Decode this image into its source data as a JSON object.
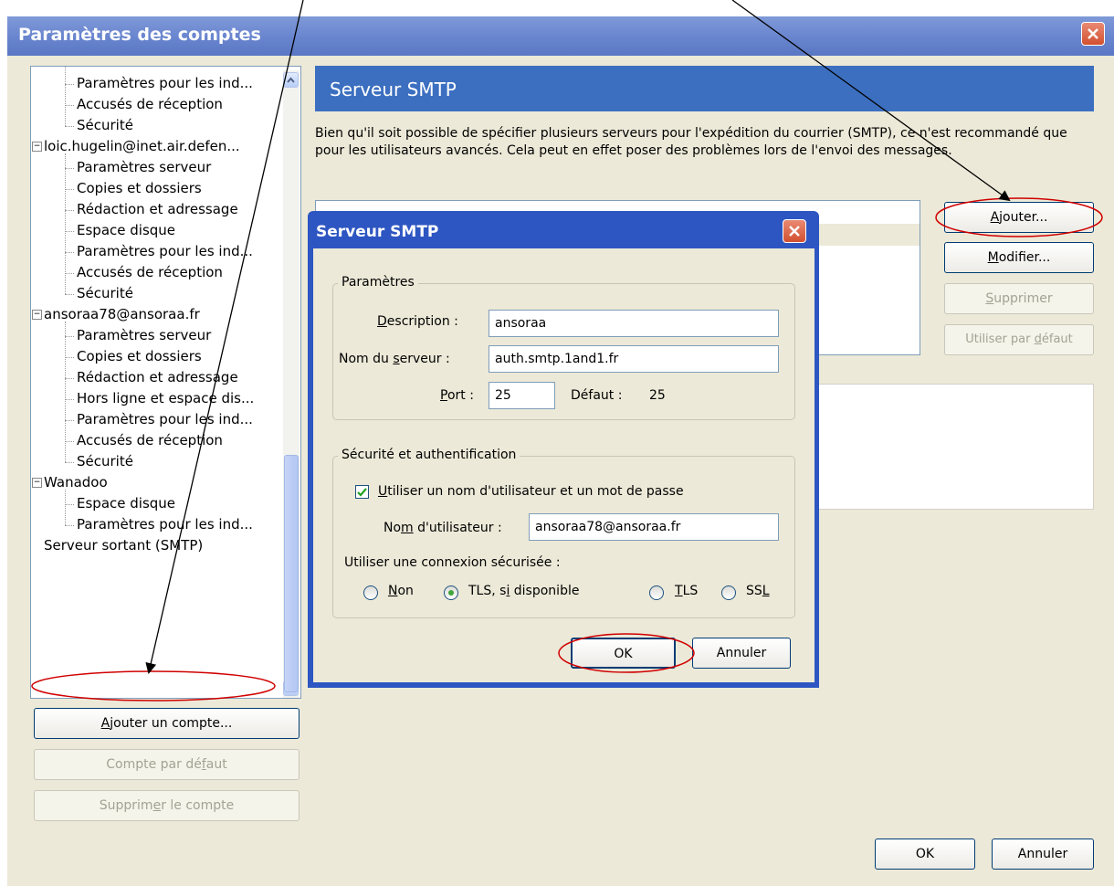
{
  "window": {
    "title": "Paramètres des comptes"
  },
  "tree": {
    "items": [
      {
        "label": "Paramètres pour les ind...",
        "level": 1
      },
      {
        "label": "Accusés de réception",
        "level": 1
      },
      {
        "label": "Sécurité",
        "level": 1
      },
      {
        "label": "loic.hugelin@inet.air.defen...",
        "level": 0
      },
      {
        "label": "Paramètres serveur",
        "level": 1
      },
      {
        "label": "Copies et dossiers",
        "level": 1
      },
      {
        "label": "Rédaction et adressage",
        "level": 1
      },
      {
        "label": "Espace disque",
        "level": 1
      },
      {
        "label": "Paramètres pour les ind...",
        "level": 1
      },
      {
        "label": "Accusés de réception",
        "level": 1
      },
      {
        "label": "Sécurité",
        "level": 1
      },
      {
        "label": "ansoraa78@ansoraa.fr",
        "level": 0
      },
      {
        "label": "Paramètres serveur",
        "level": 1
      },
      {
        "label": "Copies et dossiers",
        "level": 1
      },
      {
        "label": "Rédaction et adressage",
        "level": 1
      },
      {
        "label": "Hors ligne et espace dis...",
        "level": 1
      },
      {
        "label": "Paramètres pour les ind...",
        "level": 1
      },
      {
        "label": "Accusés de réception",
        "level": 1
      },
      {
        "label": "Sécurité",
        "level": 1
      },
      {
        "label": "Wanadoo",
        "level": 0
      },
      {
        "label": "Espace disque",
        "level": 1
      },
      {
        "label": "Paramètres pour les ind...",
        "level": 1
      },
      {
        "label": "Serveur sortant (SMTP)",
        "level": 0
      }
    ]
  },
  "left_buttons": {
    "add_account": {
      "pre": "",
      "key": "A",
      "post": "jouter un compte..."
    },
    "default_account": {
      "pre": "Compte par dé",
      "key": "f",
      "post": "aut"
    },
    "remove_account": {
      "pre": "Supprim",
      "key": "e",
      "post": "r le compte"
    }
  },
  "smtp_panel": {
    "banner": "Serveur SMTP",
    "description": "Bien qu'il soit possible de spécifier plusieurs serveurs pour l'expédition du courrier (SMTP), ce n'est recommandé que pour les utilisateurs avancés. Cela peut en effet poser des problèmes lors de l'envoi des messages.",
    "buttons": {
      "add": {
        "pre": "",
        "key": "A",
        "post": "jouter..."
      },
      "modify": {
        "pre": "",
        "key": "M",
        "post": "odifier..."
      },
      "delete": {
        "pre": "",
        "key": "S",
        "post": "upprimer"
      },
      "default": {
        "pre": "Utiliser par ",
        "key": "d",
        "post": "éfaut"
      }
    }
  },
  "dialog": {
    "title": "Serveur SMTP",
    "params_group": "Paramètres",
    "description": {
      "pre": "",
      "key": "D",
      "post": "escription :",
      "value": "ansoraa"
    },
    "server_name": {
      "pre": "Nom du ",
      "key": "s",
      "post": "erveur :",
      "value": "auth.smtp.1and1.fr"
    },
    "port": {
      "pre": "",
      "key": "P",
      "post": "ort :",
      "value": "25",
      "default_label": "Défaut :",
      "default_value": "25"
    },
    "security_group": "Sécurité et authentification",
    "use_auth": {
      "pre": "",
      "key": "U",
      "post": "tiliser un nom d'utilisateur et un mot de passe",
      "checked": true
    },
    "username": {
      "pre": "No",
      "key": "m",
      "post": " d'utilisateur :",
      "value": "ansoraa78@ansoraa.fr"
    },
    "secure_label": "Utiliser une connexion sécurisée :",
    "radios": [
      {
        "pre": "",
        "key": "N",
        "post": "on",
        "selected": false
      },
      {
        "pre": "TLS, s",
        "key": "i",
        "post": " disponible",
        "selected": true
      },
      {
        "pre": "",
        "key": "T",
        "post": "LS",
        "selected": false
      },
      {
        "pre": "SS",
        "key": "L",
        "post": "",
        "selected": false
      }
    ],
    "ok": "OK",
    "cancel": "Annuler"
  },
  "footer": {
    "ok": "OK",
    "cancel": "Annuler"
  }
}
